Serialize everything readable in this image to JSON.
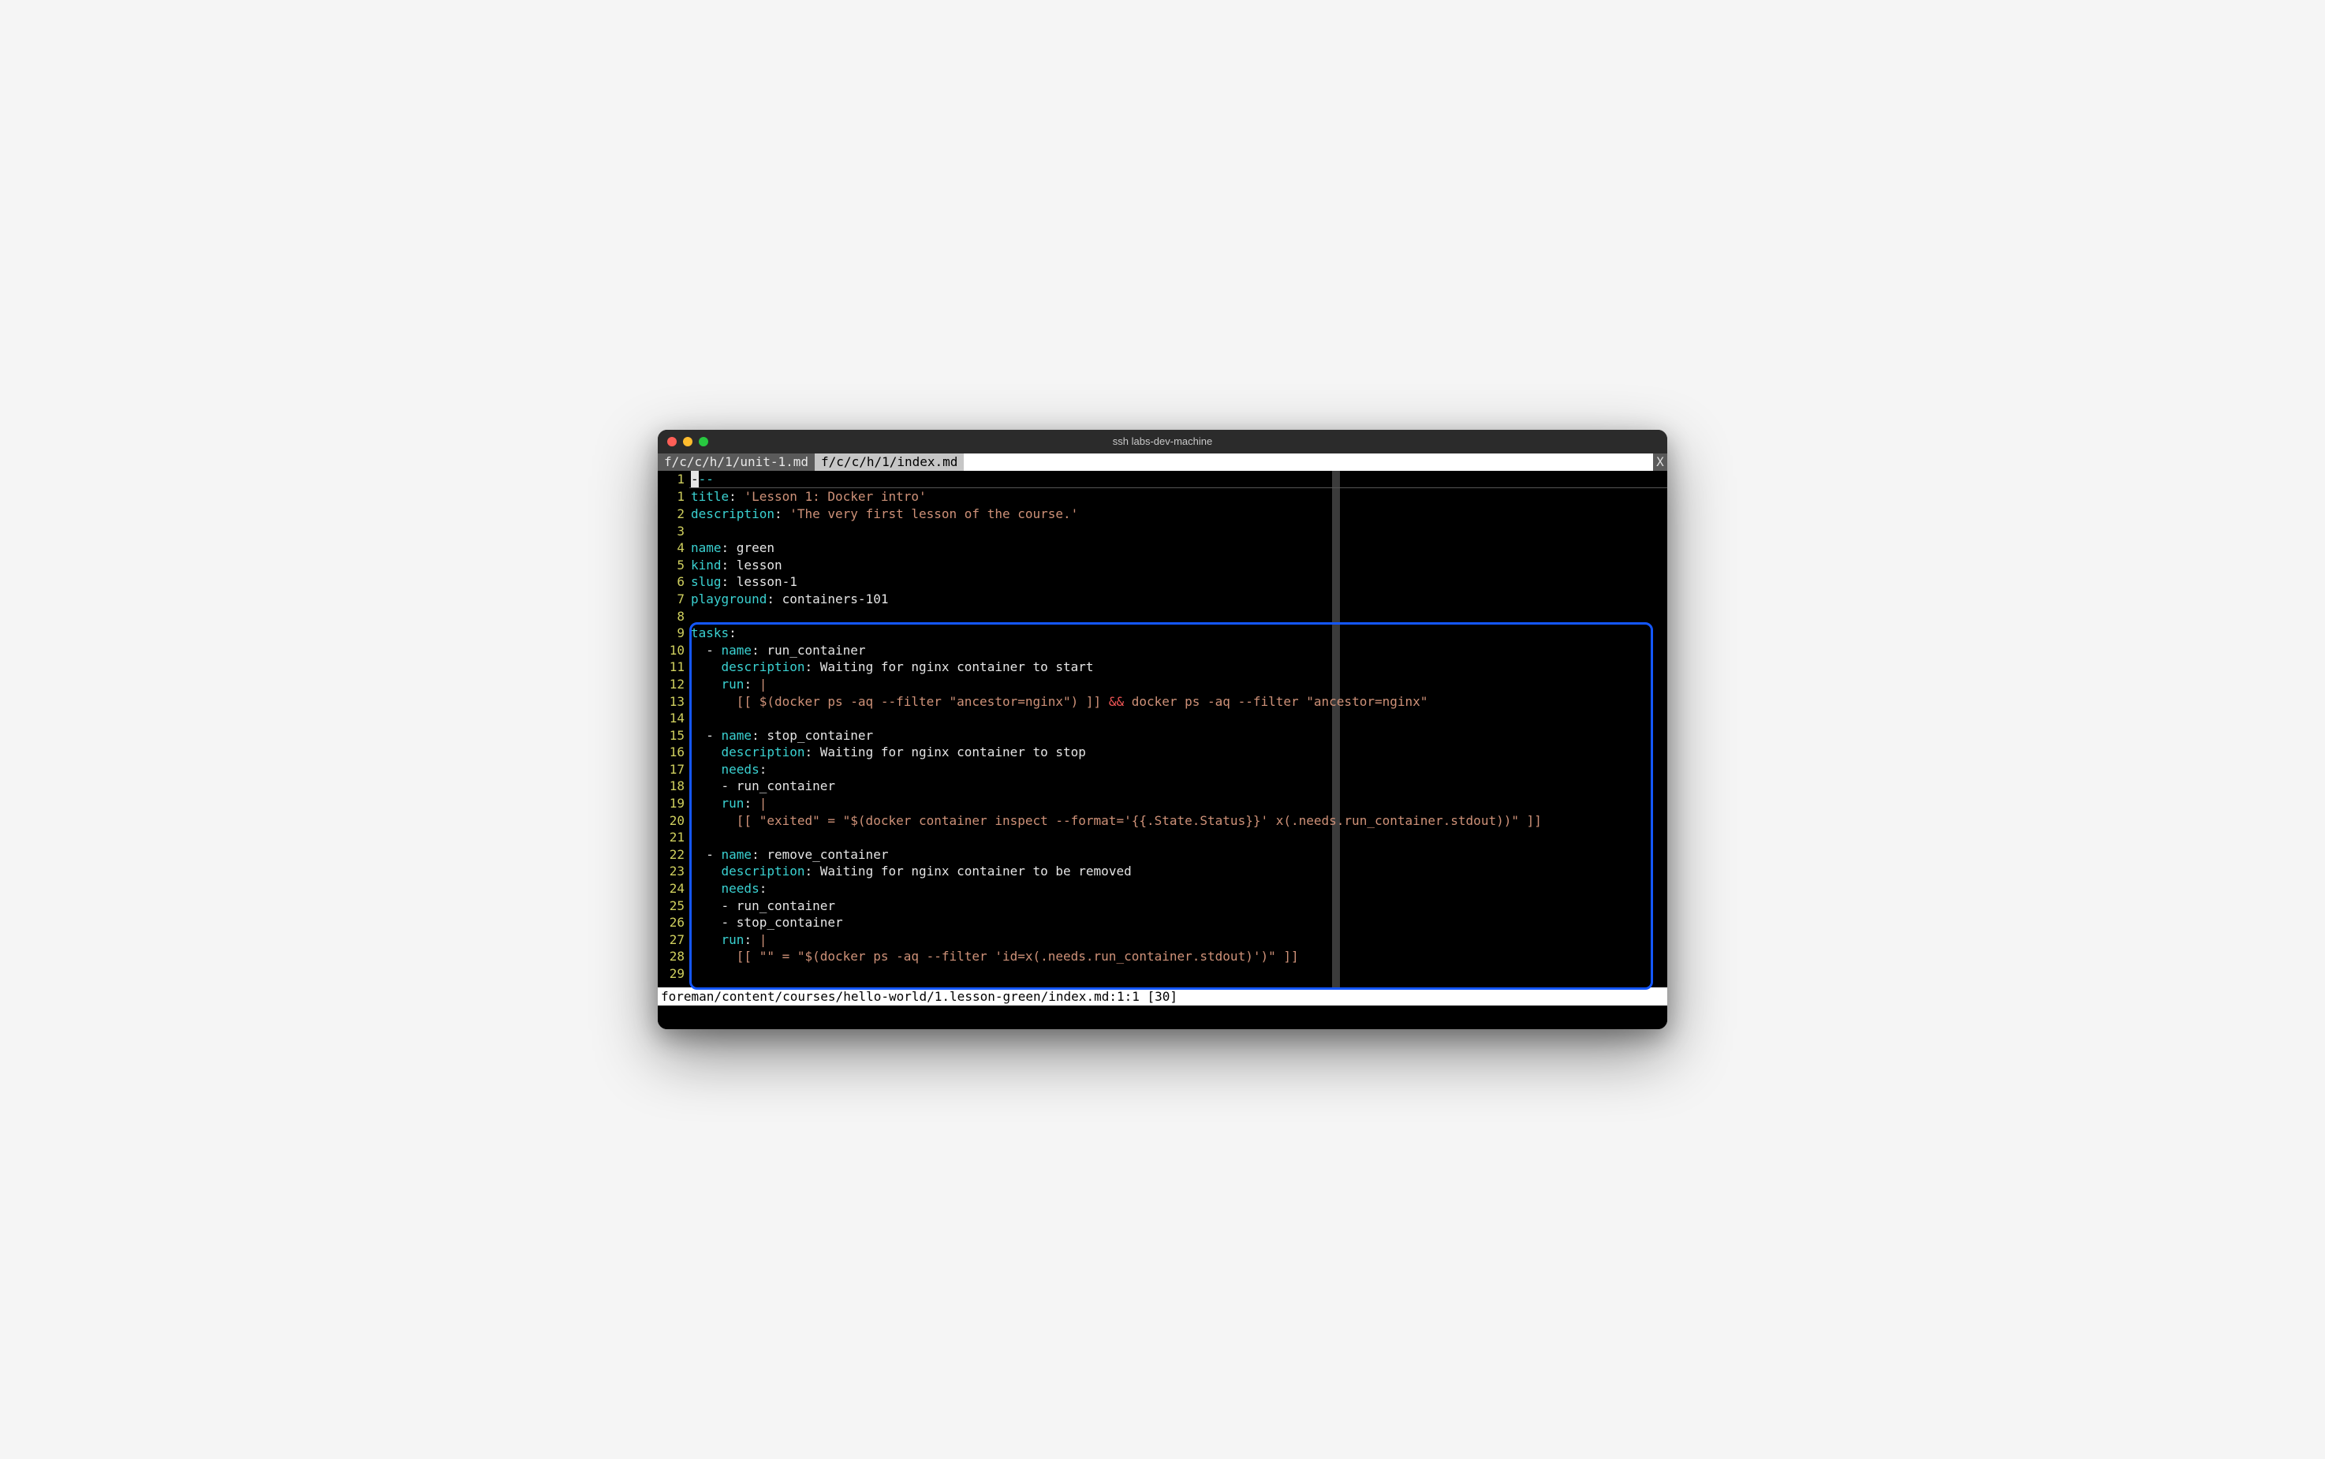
{
  "window": {
    "title": "ssh labs-dev-machine",
    "close_x": "X"
  },
  "tabs": [
    {
      "label": "f/c/c/h/1/unit-1.md",
      "active": false
    },
    {
      "label": "f/c/c/h/1/index.md",
      "active": true
    }
  ],
  "frontmatter_prefix": "--",
  "gutter_prefix": "1",
  "lines": [
    {
      "n": "1",
      "segments": [
        {
          "cls": "k",
          "t": "title"
        },
        {
          "cls": "t",
          "t": ": "
        },
        {
          "cls": "s",
          "t": "'Lesson 1: Docker intro'"
        }
      ]
    },
    {
      "n": "2",
      "segments": [
        {
          "cls": "k",
          "t": "description"
        },
        {
          "cls": "t",
          "t": ": "
        },
        {
          "cls": "s",
          "t": "'The very first lesson of the course.'"
        }
      ]
    },
    {
      "n": "3",
      "segments": []
    },
    {
      "n": "4",
      "segments": [
        {
          "cls": "k",
          "t": "name"
        },
        {
          "cls": "t",
          "t": ": green"
        }
      ]
    },
    {
      "n": "5",
      "segments": [
        {
          "cls": "k",
          "t": "kind"
        },
        {
          "cls": "t",
          "t": ": lesson"
        }
      ]
    },
    {
      "n": "6",
      "segments": [
        {
          "cls": "k",
          "t": "slug"
        },
        {
          "cls": "t",
          "t": ": lesson-1"
        }
      ]
    },
    {
      "n": "7",
      "segments": [
        {
          "cls": "k",
          "t": "playground"
        },
        {
          "cls": "t",
          "t": ": containers-101"
        }
      ]
    },
    {
      "n": "8",
      "segments": []
    },
    {
      "n": "9",
      "segments": [
        {
          "cls": "k",
          "t": "tasks"
        },
        {
          "cls": "t",
          "t": ":"
        }
      ]
    },
    {
      "n": "10",
      "segments": [
        {
          "cls": "t",
          "t": "  - "
        },
        {
          "cls": "k",
          "t": "name"
        },
        {
          "cls": "t",
          "t": ": run_container"
        }
      ]
    },
    {
      "n": "11",
      "segments": [
        {
          "cls": "t",
          "t": "    "
        },
        {
          "cls": "k",
          "t": "description"
        },
        {
          "cls": "t",
          "t": ": Waiting for nginx container to start"
        }
      ]
    },
    {
      "n": "12",
      "segments": [
        {
          "cls": "t",
          "t": "    "
        },
        {
          "cls": "k",
          "t": "run"
        },
        {
          "cls": "t",
          "t": ": "
        },
        {
          "cls": "s",
          "t": "|"
        }
      ]
    },
    {
      "n": "13",
      "segments": [
        {
          "cls": "s",
          "t": "      [[ $(docker ps -aq --filter \"ancestor=nginx\") ]] "
        },
        {
          "cls": "and",
          "t": "&&"
        },
        {
          "cls": "s",
          "t": " docker ps -aq --filter \"ancestor=nginx\""
        }
      ]
    },
    {
      "n": "14",
      "segments": []
    },
    {
      "n": "15",
      "segments": [
        {
          "cls": "t",
          "t": "  - "
        },
        {
          "cls": "k",
          "t": "name"
        },
        {
          "cls": "t",
          "t": ": stop_container"
        }
      ]
    },
    {
      "n": "16",
      "segments": [
        {
          "cls": "t",
          "t": "    "
        },
        {
          "cls": "k",
          "t": "description"
        },
        {
          "cls": "t",
          "t": ": Waiting for nginx container to stop"
        }
      ]
    },
    {
      "n": "17",
      "segments": [
        {
          "cls": "t",
          "t": "    "
        },
        {
          "cls": "k",
          "t": "needs"
        },
        {
          "cls": "t",
          "t": ":"
        }
      ]
    },
    {
      "n": "18",
      "segments": [
        {
          "cls": "t",
          "t": "    - run_container"
        }
      ]
    },
    {
      "n": "19",
      "segments": [
        {
          "cls": "t",
          "t": "    "
        },
        {
          "cls": "k",
          "t": "run"
        },
        {
          "cls": "t",
          "t": ": "
        },
        {
          "cls": "s",
          "t": "|"
        }
      ]
    },
    {
      "n": "20",
      "segments": [
        {
          "cls": "s",
          "t": "      [[ \"exited\" = \"$(docker container inspect --format='{{.State.Status}}' x(.needs.run_container.stdout))\" ]]"
        }
      ]
    },
    {
      "n": "21",
      "segments": []
    },
    {
      "n": "22",
      "segments": [
        {
          "cls": "t",
          "t": "  - "
        },
        {
          "cls": "k",
          "t": "name"
        },
        {
          "cls": "t",
          "t": ": remove_container"
        }
      ]
    },
    {
      "n": "23",
      "segments": [
        {
          "cls": "t",
          "t": "    "
        },
        {
          "cls": "k",
          "t": "description"
        },
        {
          "cls": "t",
          "t": ": Waiting for nginx container to be removed"
        }
      ]
    },
    {
      "n": "24",
      "segments": [
        {
          "cls": "t",
          "t": "    "
        },
        {
          "cls": "k",
          "t": "needs"
        },
        {
          "cls": "t",
          "t": ":"
        }
      ]
    },
    {
      "n": "25",
      "segments": [
        {
          "cls": "t",
          "t": "    - run_container"
        }
      ]
    },
    {
      "n": "26",
      "segments": [
        {
          "cls": "t",
          "t": "    - stop_container"
        }
      ]
    },
    {
      "n": "27",
      "segments": [
        {
          "cls": "t",
          "t": "    "
        },
        {
          "cls": "k",
          "t": "run"
        },
        {
          "cls": "t",
          "t": ": "
        },
        {
          "cls": "s",
          "t": "|"
        }
      ]
    },
    {
      "n": "28",
      "segments": [
        {
          "cls": "s",
          "t": "      [[ \"\" = \"$(docker ps -aq --filter 'id=x(.needs.run_container.stdout)')\" ]]"
        }
      ]
    },
    {
      "n": "29",
      "segments": []
    }
  ],
  "highlight": {
    "from": 9,
    "to": 29
  },
  "statusbar": "foreman/content/courses/hello-world/1.lesson-green/index.md:1:1 [30]"
}
